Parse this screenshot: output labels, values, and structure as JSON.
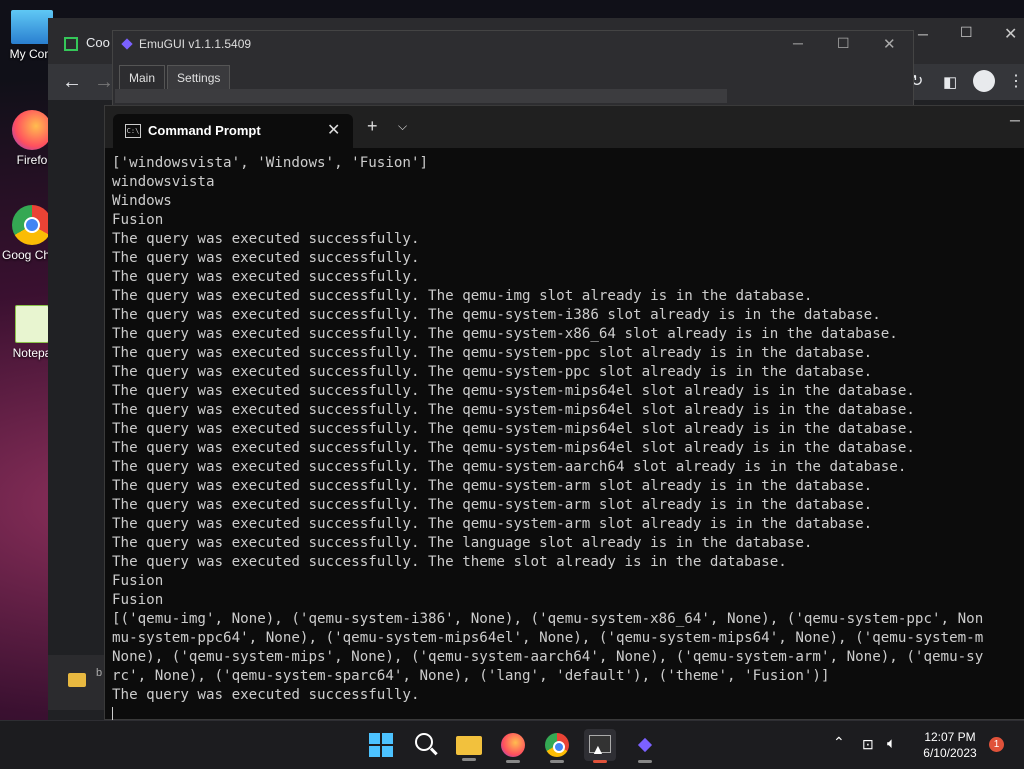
{
  "desktop": {
    "icons": [
      {
        "label": "My Com",
        "icon": "computer-icon",
        "color": "#2aa3e0"
      },
      {
        "label": "Firefo",
        "icon": "firefox-icon",
        "color": "#ff7139"
      },
      {
        "label": "Goog Chron",
        "icon": "chrome-icon",
        "color": "#34a853"
      },
      {
        "label": "Notepa",
        "icon": "notepad-plus-icon",
        "color": "#8bc34a"
      }
    ]
  },
  "chrome": {
    "tab_title": "Coo"
  },
  "emugui": {
    "title": "EmuGUI v1.1.1.5409",
    "tabs": [
      "Main",
      "Settings"
    ]
  },
  "cmd": {
    "tab_title": "Command Prompt",
    "icon_text": "C:\\",
    "lines": [
      "['windowsvista', 'Windows', 'Fusion']",
      "windowsvista",
      "Windows",
      "Fusion",
      "The query was executed successfully.",
      "The query was executed successfully.",
      "The query was executed successfully.",
      "The query was executed successfully. The qemu-img slot already is in the database.",
      "The query was executed successfully. The qemu-system-i386 slot already is in the database.",
      "The query was executed successfully. The qemu-system-x86_64 slot already is in the database.",
      "The query was executed successfully. The qemu-system-ppc slot already is in the database.",
      "The query was executed successfully. The qemu-system-ppc slot already is in the database.",
      "The query was executed successfully. The qemu-system-mips64el slot already is in the database.",
      "The query was executed successfully. The qemu-system-mips64el slot already is in the database.",
      "The query was executed successfully. The qemu-system-mips64el slot already is in the database.",
      "The query was executed successfully. The qemu-system-mips64el slot already is in the database.",
      "The query was executed successfully. The qemu-system-aarch64 slot already is in the database.",
      "The query was executed successfully. The qemu-system-arm slot already is in the database.",
      "The query was executed successfully. The qemu-system-arm slot already is in the database.",
      "The query was executed successfully. The qemu-system-arm slot already is in the database.",
      "The query was executed successfully. The language slot already is in the database.",
      "The query was executed successfully. The theme slot already is in the database.",
      "Fusion",
      "Fusion",
      "[('qemu-img', None), ('qemu-system-i386', None), ('qemu-system-x86_64', None), ('qemu-system-ppc', Non",
      "mu-system-ppc64', None), ('qemu-system-mips64el', None), ('qemu-system-mips64', None), ('qemu-system-m",
      "None), ('qemu-system-mips', None), ('qemu-system-aarch64', None), ('qemu-system-arm', None), ('qemu-sy",
      "rc', None), ('qemu-system-sparc64', None), ('lang', 'default'), ('theme', 'Fusion')]",
      "The query was executed successfully."
    ]
  },
  "side_window": {
    "label": "b"
  },
  "taskbar": {
    "apps": [
      {
        "name": "start-button",
        "icon": "windows-icon",
        "color": "#3b9cff"
      },
      {
        "name": "search-button",
        "icon": "search-icon",
        "color": "#ffffff"
      },
      {
        "name": "file-explorer-button",
        "icon": "folder-icon",
        "color": "#f2c13d"
      },
      {
        "name": "firefox-button",
        "icon": "firefox-icon",
        "color": "#ff7139"
      },
      {
        "name": "chrome-button",
        "icon": "chrome-icon",
        "color": "#34a853"
      },
      {
        "name": "terminal-button",
        "icon": "terminal-icon",
        "color": "#cccccc"
      },
      {
        "name": "emugui-button",
        "icon": "emugui-icon",
        "color": "#7b61ff"
      }
    ],
    "time": "12:07 PM",
    "date": "6/10/2023",
    "notification_count": "1"
  }
}
